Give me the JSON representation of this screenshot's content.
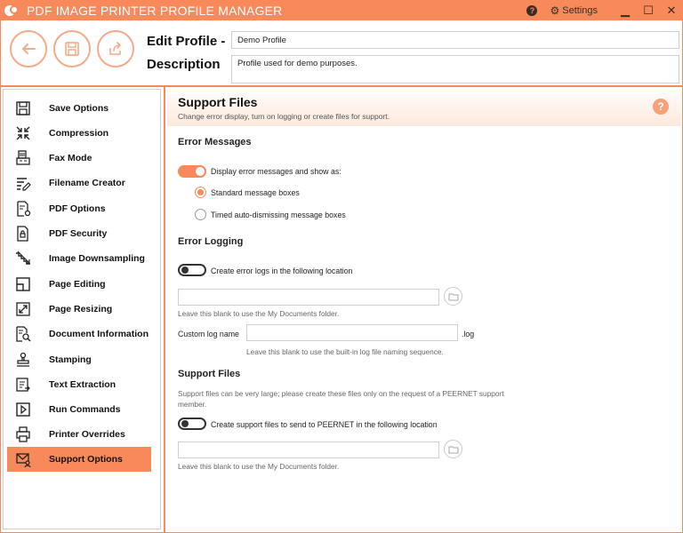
{
  "app": {
    "title": "PDF IMAGE PRINTER PROFILE MANAGER",
    "settings_label": "Settings",
    "help_glyph": "?",
    "minimize_glyph": "▁",
    "maximize_glyph": "☐",
    "close_glyph": "✕",
    "accent_color": "#f7895a"
  },
  "header": {
    "edit_profile_label": "Edit Profile -",
    "description_label": "Description",
    "profile_name": "Demo Profile",
    "profile_description": "Profile used for demo purposes.",
    "buttons": [
      "back-icon",
      "save-icon",
      "export-icon"
    ]
  },
  "sidebar": {
    "items": [
      {
        "label": "Save Options",
        "icon": "save-icon",
        "active": false
      },
      {
        "label": "Compression",
        "icon": "compress-icon",
        "active": false
      },
      {
        "label": "Fax Mode",
        "icon": "fax-icon",
        "active": false
      },
      {
        "label": "Filename Creator",
        "icon": "filename-icon",
        "active": false
      },
      {
        "label": "PDF Options",
        "icon": "pdf-options-icon",
        "active": false
      },
      {
        "label": "PDF Security",
        "icon": "lock-icon",
        "active": false
      },
      {
        "label": "Image Downsampling",
        "icon": "downsample-icon",
        "active": false
      },
      {
        "label": "Page Editing",
        "icon": "page-edit-icon",
        "active": false
      },
      {
        "label": "Page Resizing",
        "icon": "resize-icon",
        "active": false
      },
      {
        "label": "Document Information",
        "icon": "document-search-icon",
        "active": false
      },
      {
        "label": "Stamping",
        "icon": "stamp-icon",
        "active": false
      },
      {
        "label": "Text Extraction",
        "icon": "text-extract-icon",
        "active": false
      },
      {
        "label": "Run Commands",
        "icon": "run-icon",
        "active": false
      },
      {
        "label": "Printer Overrides",
        "icon": "printer-icon",
        "active": false
      },
      {
        "label": "Support Options",
        "icon": "support-mail-icon",
        "active": true
      }
    ]
  },
  "content": {
    "title": "Support Files",
    "subtitle": "Change error display, turn on logging or create files for support.",
    "help_glyph": "?",
    "error_messages": {
      "heading": "Error Messages",
      "toggle_label": "Display error messages and show as:",
      "toggle_on": true,
      "options": [
        {
          "label": "Standard message boxes",
          "checked": true
        },
        {
          "label": "Timed auto-dismissing message boxes",
          "checked": false
        }
      ]
    },
    "error_logging": {
      "heading": "Error Logging",
      "toggle_label": "Create error logs in the following location",
      "toggle_on": false,
      "location_value": "",
      "location_hint": "Leave this blank to use the My Documents folder.",
      "custom_log_label": "Custom log name",
      "custom_log_value": "",
      "log_ext": ".log",
      "custom_log_hint": "Leave this blank to use the built-in log file naming sequence."
    },
    "support_files": {
      "heading": "Support Files",
      "note": "Support files can be very large; please create these files only on the request of a PEERNET support member.",
      "toggle_label": "Create support files to send to PEERNET in the following location",
      "toggle_on": false,
      "location_value": "",
      "location_hint": "Leave this blank to use the My Documents folder."
    }
  }
}
